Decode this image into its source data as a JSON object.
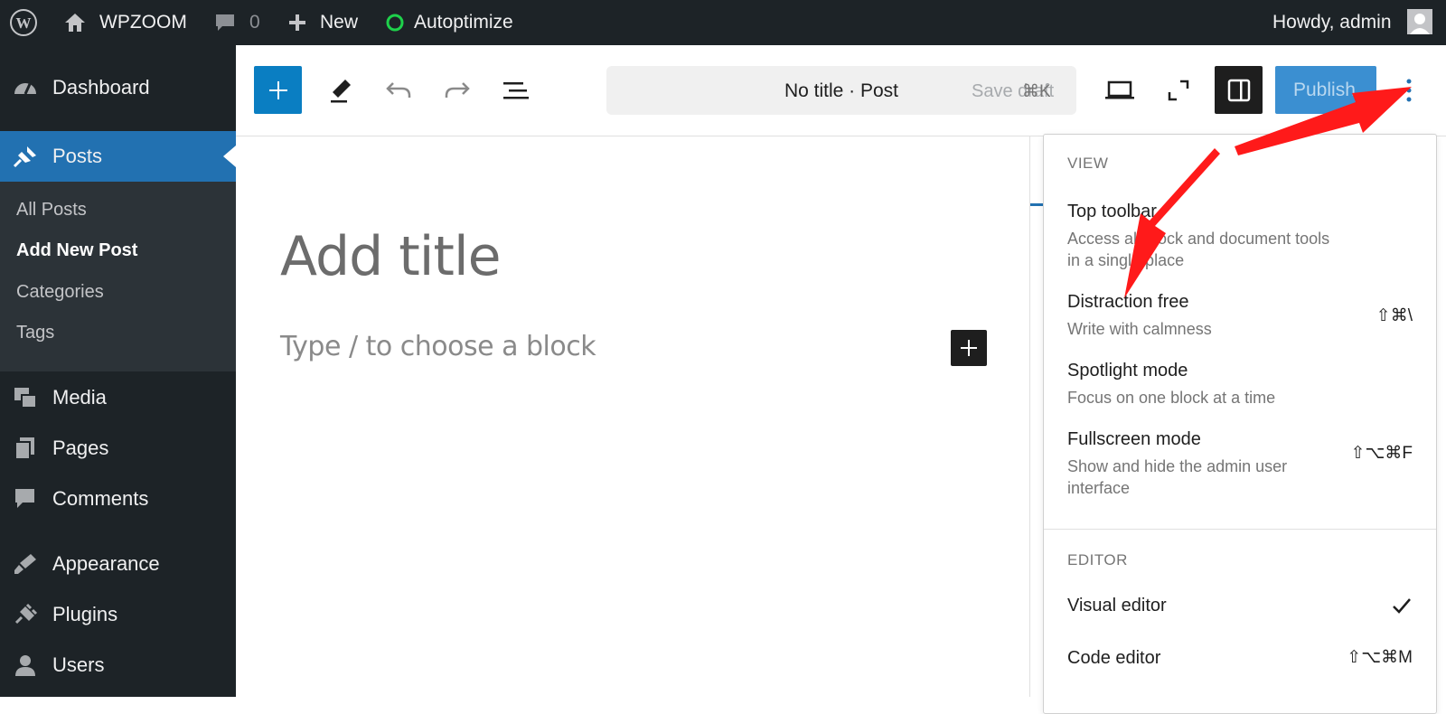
{
  "admin_bar": {
    "site_name": "WPZOOM",
    "comments_count": "0",
    "new_label": "New",
    "autoptimize_label": "Autoptimize",
    "howdy": "Howdy, admin"
  },
  "sidebar": {
    "items": [
      {
        "label": "Dashboard",
        "icon": "dashboard-icon"
      },
      {
        "label": "Posts",
        "icon": "pin-icon",
        "active": true
      },
      {
        "label": "Media",
        "icon": "media-icon"
      },
      {
        "label": "Pages",
        "icon": "pages-icon"
      },
      {
        "label": "Comments",
        "icon": "comment-icon"
      },
      {
        "label": "Appearance",
        "icon": "brush-icon"
      },
      {
        "label": "Plugins",
        "icon": "plugin-icon"
      },
      {
        "label": "Users",
        "icon": "user-icon"
      }
    ],
    "posts_submenu": [
      "All Posts",
      "Add New Post",
      "Categories",
      "Tags"
    ]
  },
  "editor_header": {
    "document_title": "No title · Post",
    "save_draft": "Save draft",
    "save_shortcut": "⌘K",
    "publish_label": "Publish"
  },
  "canvas": {
    "title_placeholder": "Add title",
    "block_placeholder": "Type / to choose a block"
  },
  "options_menu": {
    "view_label": "VIEW",
    "view_items": [
      {
        "title": "Top toolbar",
        "desc": "Access all block and document tools in a single place",
        "shortcut": ""
      },
      {
        "title": "Distraction free",
        "desc": "Write with calmness",
        "shortcut": "⇧⌘\\"
      },
      {
        "title": "Spotlight mode",
        "desc": "Focus on one block at a time",
        "shortcut": ""
      },
      {
        "title": "Fullscreen mode",
        "desc": "Show and hide the admin user interface",
        "shortcut": "⇧⌥⌘F"
      }
    ],
    "editor_label": "EDITOR",
    "editor_items": [
      {
        "title": "Visual editor",
        "checked": true,
        "shortcut": ""
      },
      {
        "title": "Code editor",
        "checked": false,
        "shortcut": "⇧⌥⌘M"
      }
    ]
  },
  "colors": {
    "admin_dark": "#1d2327",
    "accent_blue": "#2271b1",
    "wp_blue": "#0a7ec2",
    "annotation_red": "#ff1a1a"
  }
}
